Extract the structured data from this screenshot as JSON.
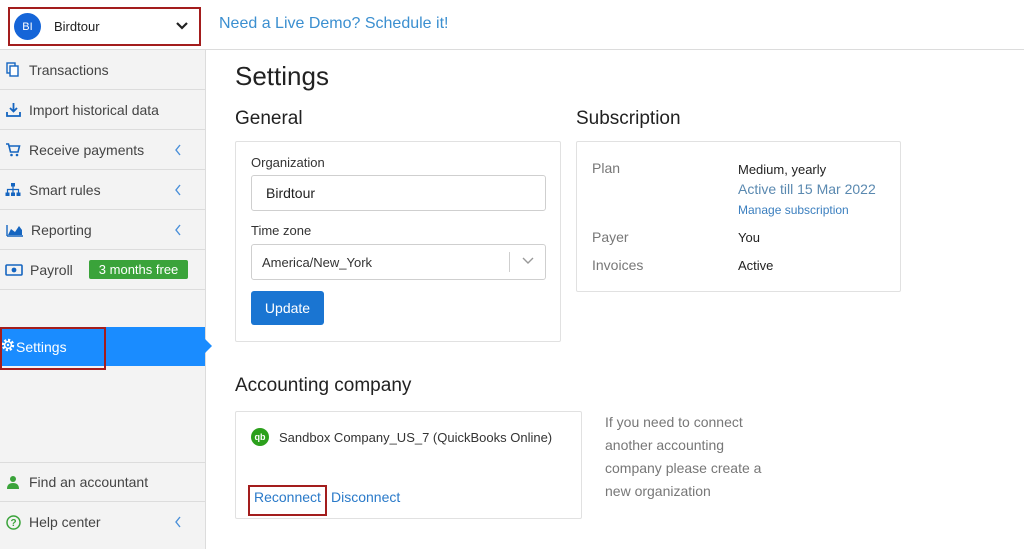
{
  "header": {
    "org_initials": "BI",
    "org_name": "Birdtour",
    "demo_link": "Need a Live Demo? Schedule it!"
  },
  "sidebar": {
    "items": [
      {
        "label": "Transactions",
        "icon": "copy-icon"
      },
      {
        "label": "Import historical data",
        "icon": "download-icon"
      },
      {
        "label": "Receive payments",
        "icon": "cart-icon",
        "expandable": true
      },
      {
        "label": "Smart rules",
        "icon": "sitemap-icon",
        "expandable": true
      },
      {
        "label": "Reporting",
        "icon": "area-chart-icon",
        "expandable": true
      },
      {
        "label": "Payroll",
        "icon": "money-icon",
        "badge": "3 months free"
      }
    ],
    "active_item": {
      "label": "Settings",
      "icon": "gear-icon"
    },
    "bottom_items": [
      {
        "label": "Find an accountant",
        "icon": "user-icon"
      },
      {
        "label": "Help center",
        "icon": "question-circle-icon",
        "expandable": true
      }
    ]
  },
  "main": {
    "title": "Settings",
    "general": {
      "title": "General",
      "organization_label": "Organization",
      "organization_value": "Birdtour",
      "timezone_label": "Time zone",
      "timezone_value": "America/New_York",
      "update_button": "Update"
    },
    "subscription": {
      "title": "Subscription",
      "plan_label": "Plan",
      "plan_value": "Medium, yearly",
      "plan_note": "Active till 15 Mar 2022",
      "manage_link": "Manage subscription",
      "payer_label": "Payer",
      "payer_value": "You",
      "invoices_label": "Invoices",
      "invoices_value": "Active"
    },
    "accounting": {
      "title": "Accounting company",
      "company_name": "Sandbox Company_US_7 (QuickBooks Online)",
      "company_icon_text": "qb",
      "reconnect_link": "Reconnect",
      "disconnect_link": "Disconnect",
      "help_text": "If you need to connect another accounting company please create a new organization"
    }
  },
  "colors": {
    "primary": "#1a8cff",
    "button": "#1a75d2",
    "highlight_border": "#a31d1d",
    "badge_green": "#3aa33a",
    "quickbooks_green": "#2ca01c"
  }
}
